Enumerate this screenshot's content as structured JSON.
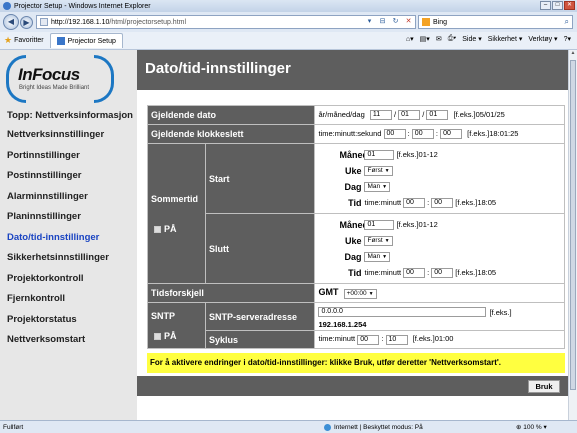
{
  "window": {
    "title": "Projector Setup - Windows Internet Explorer"
  },
  "address": {
    "host": "http://192.168.1.10",
    "path": "/html/projectorsetup.html"
  },
  "search": {
    "placeholder": "Bing"
  },
  "favorites": {
    "label": "Favoritter",
    "tab_title": "Projector Setup"
  },
  "commandbar": {
    "page": "Side",
    "safety": "Sikkerhet",
    "tools": "Verktøy"
  },
  "logo": {
    "brand": "InFocus",
    "tagline": "Bright Ideas Made Brilliant"
  },
  "menu": {
    "items": [
      "Topp: Nettverksinformasjon",
      "Nettverksinnstillinger",
      "Portinnstillinger",
      "Postinnstillinger",
      "Alarminnstillinger",
      "Planinnstillinger",
      "Dato/tid-innstillinger",
      "Sikkerhetsinnstillinger",
      "Projektorkontroll",
      "Fjernkontroll",
      "Projektorstatus",
      "Nettverksomstart"
    ],
    "active_index": 6
  },
  "page_title": "Dato/tid-innstillinger",
  "form": {
    "current_date": {
      "label": "Gjeldende dato",
      "format_label": "år/måned/dag",
      "year": "11",
      "month": "01",
      "day": "01",
      "example": "[f.eks.]05/01/25",
      "sep": "/"
    },
    "current_time": {
      "label": "Gjeldende klokkeslett",
      "format_label": "time:minutt:sekund",
      "hour": "00",
      "minute": "00",
      "second": "00",
      "example": "[f.eks.]18:01:25",
      "sep": ":"
    },
    "dst": {
      "label": "Sommertid",
      "checkbox_label": "PÅ",
      "start": {
        "label": "Start",
        "month_label": "Måned",
        "month": "01",
        "month_example": "[f.eks.]01-12",
        "week_label": "Uke",
        "week": "Først",
        "day_label": "Dag",
        "day": "Man",
        "time_label": "Tid",
        "time_format": "time:minutt",
        "hour": "00",
        "minute": "00",
        "time_example": "[f.eks.]18:05"
      },
      "end": {
        "label": "Slutt",
        "month_label": "Måned",
        "month": "01",
        "month_example": "[f.eks.]01-12",
        "week_label": "Uke",
        "week": "Først",
        "day_label": "Dag",
        "day": "Man",
        "time_label": "Tid",
        "time_format": "time:minutt",
        "hour": "00",
        "minute": "00",
        "time_example": "[f.eks.]18:05"
      }
    },
    "timezone": {
      "label": "Tidsforskjell",
      "prefix": "GMT",
      "value": "+00:00"
    },
    "sntp": {
      "label": "SNTP",
      "checkbox_label": "PÅ",
      "server_label": "SNTP-serveradresse",
      "server_value": "0.0.0.0",
      "server_example": "[f.eks.]",
      "server_example_value": "192.168.1.254",
      "cycle_label": "Syklus",
      "cycle_format": "time:minutt",
      "cycle_hour": "00",
      "cycle_minute": "10",
      "cycle_example": "[f.eks.]01:00"
    }
  },
  "note": "For å aktivere endringer i dato/tid-innstillinger: klikke Bruk, utfør deretter 'Nettverksomstart'.",
  "apply_button": "Bruk",
  "status": {
    "left": "Fullført",
    "zone": "Internett | Beskyttet modus: På",
    "zoom": "100 %"
  }
}
